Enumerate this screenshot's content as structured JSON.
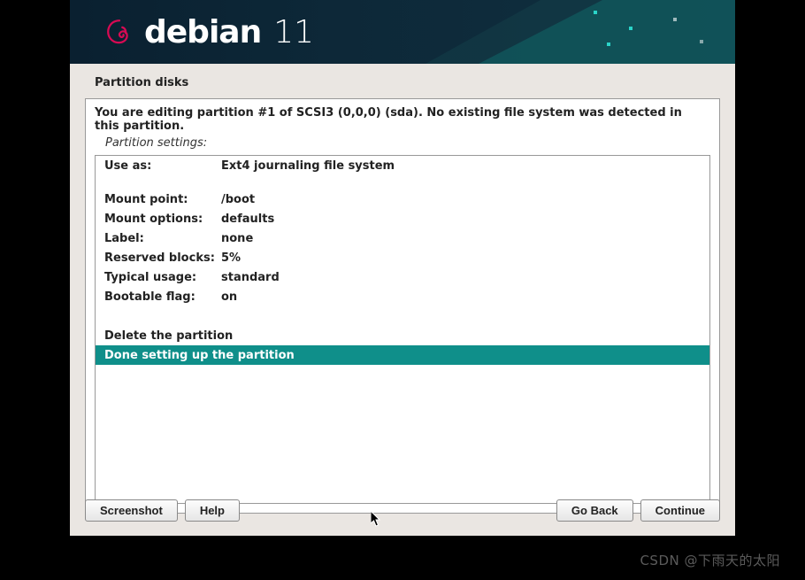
{
  "header": {
    "brand": "debian",
    "version": "11"
  },
  "page": {
    "title": "Partition disks",
    "instruction": "You are editing partition #1 of SCSI3 (0,0,0) (sda). No existing file system was detected in this partition.",
    "subtitle": "Partition settings:"
  },
  "settings": {
    "use_as": {
      "label": "Use as:",
      "value": "Ext4 journaling file system"
    },
    "mount_point": {
      "label": "Mount point:",
      "value": "/boot"
    },
    "mount_options": {
      "label": "Mount options:",
      "value": "defaults"
    },
    "label": {
      "label": "Label:",
      "value": "none"
    },
    "reserved_blocks": {
      "label": "Reserved blocks:",
      "value": "5%"
    },
    "typical_usage": {
      "label": "Typical usage:",
      "value": "standard"
    },
    "bootable_flag": {
      "label": "Bootable flag:",
      "value": "on"
    }
  },
  "actions": {
    "delete": "Delete the partition",
    "done": "Done setting up the partition"
  },
  "buttons": {
    "screenshot": "Screenshot",
    "help": "Help",
    "go_back": "Go Back",
    "continue": "Continue"
  },
  "watermark": "CSDN @下雨天的太阳"
}
